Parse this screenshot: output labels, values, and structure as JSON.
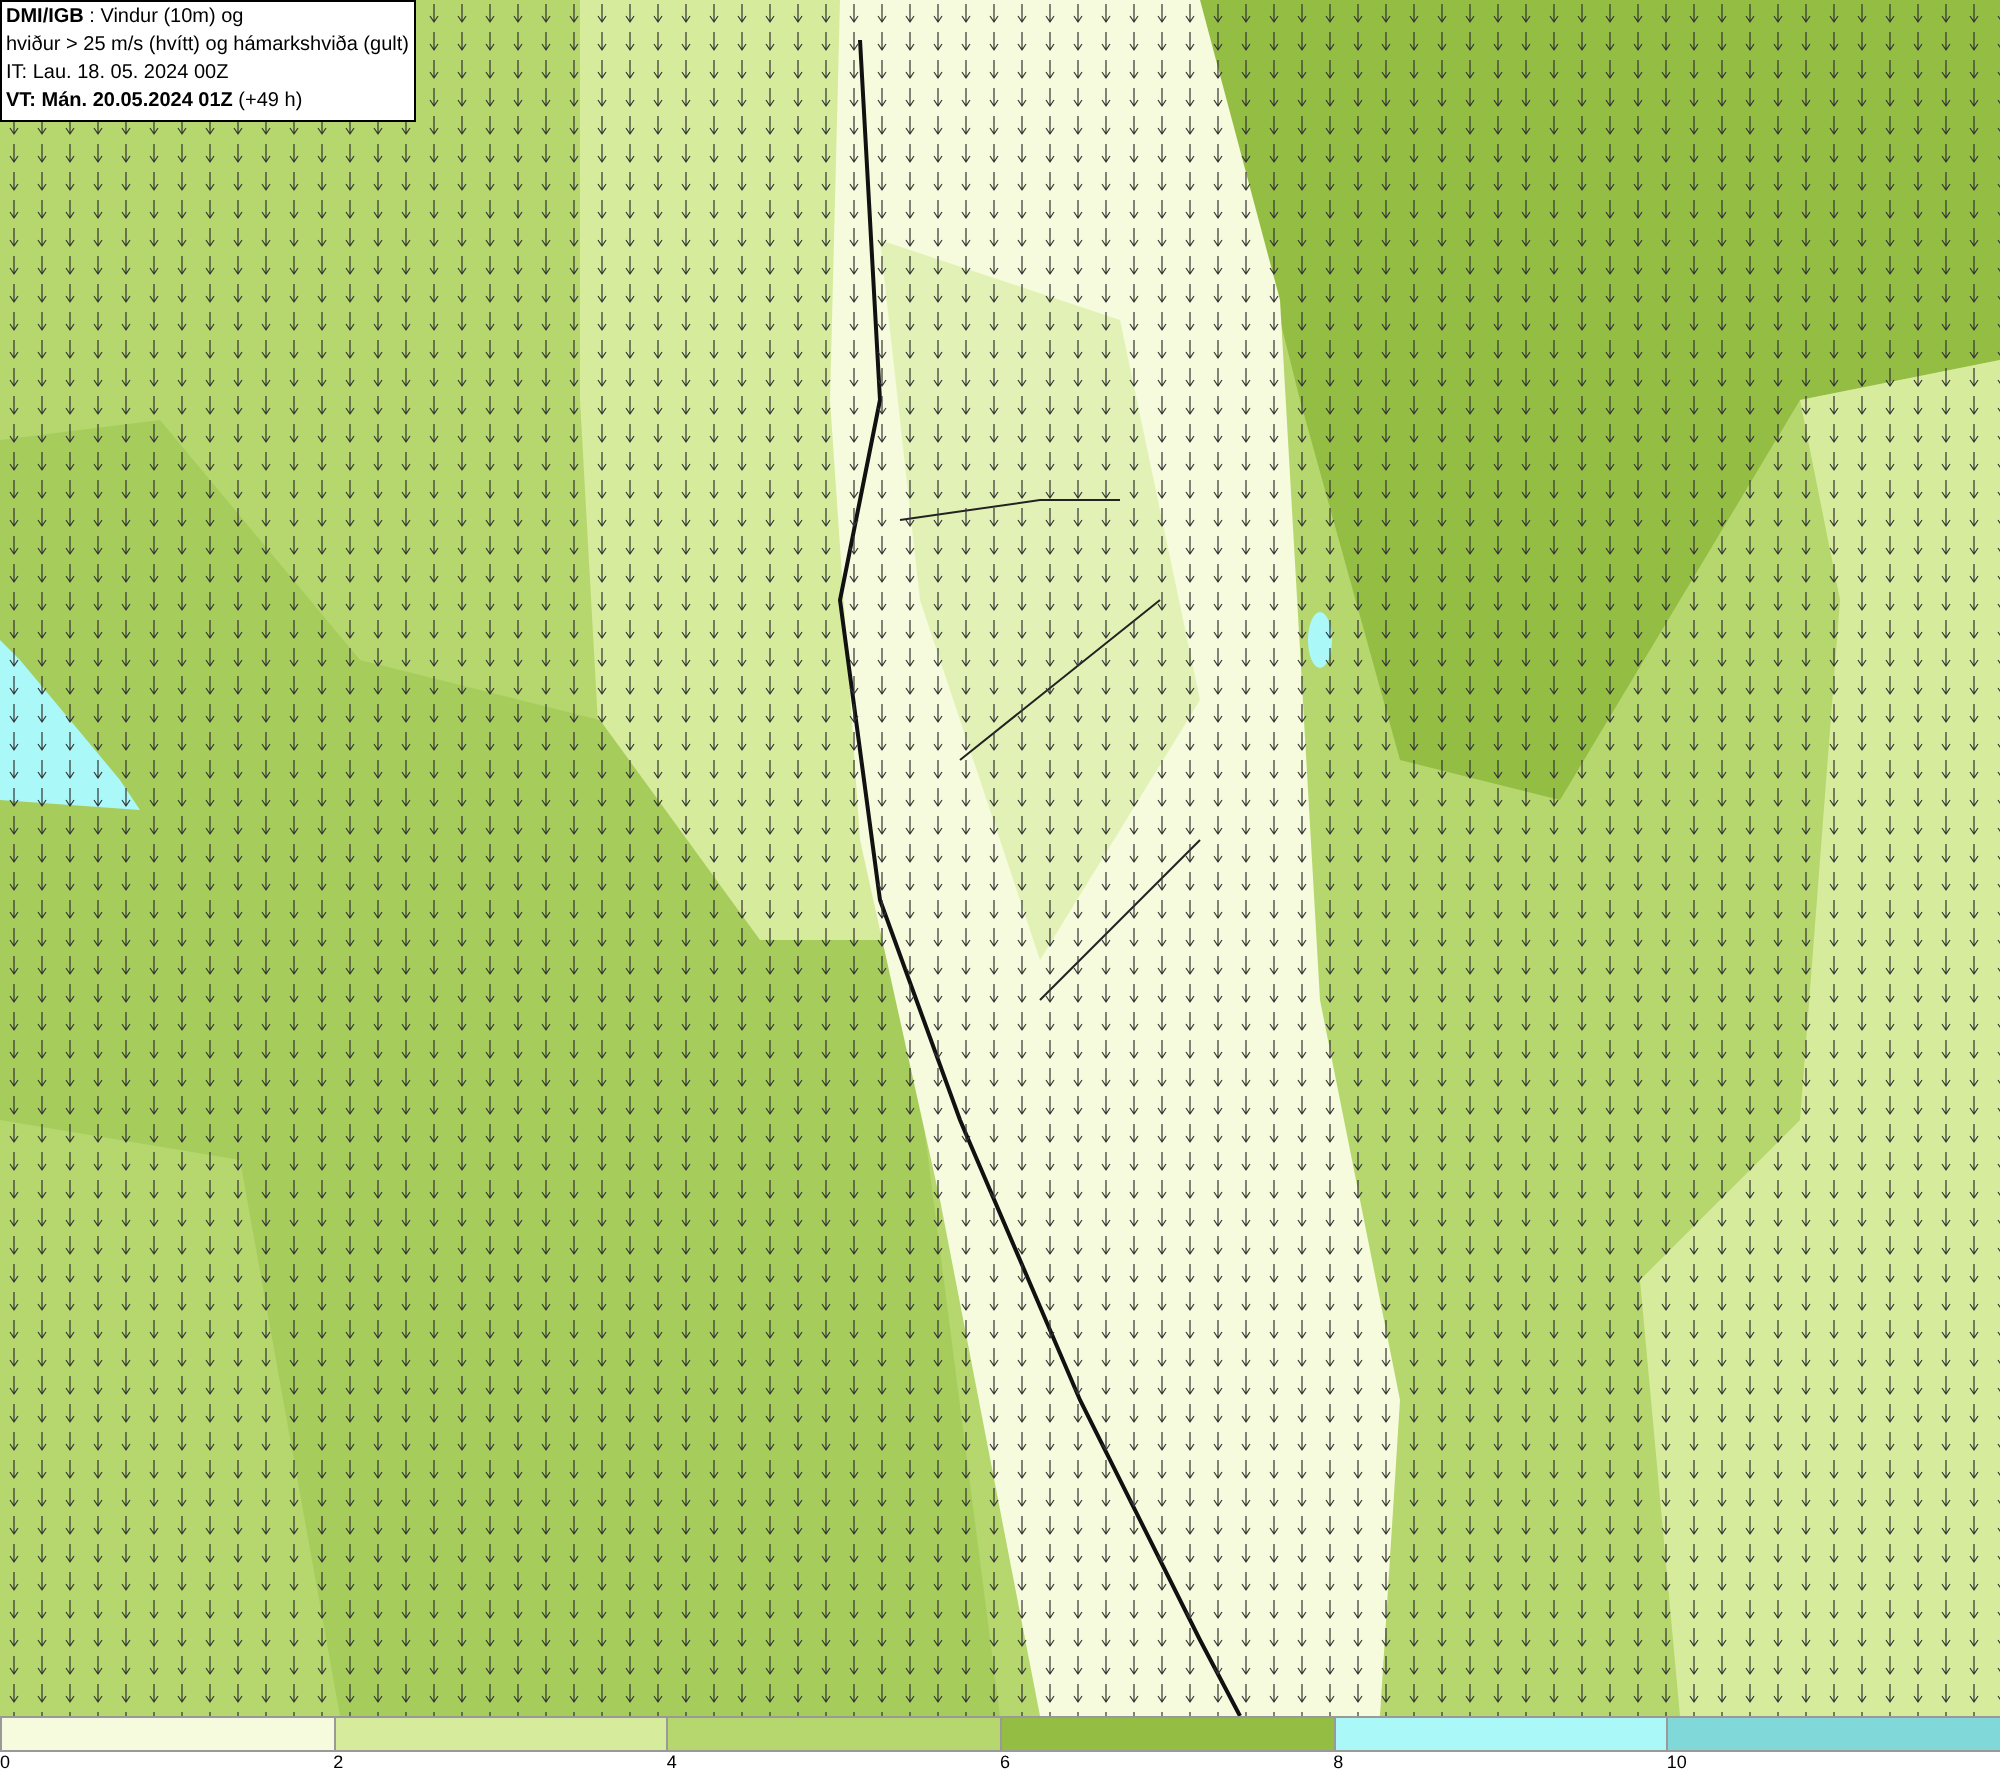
{
  "title_box": {
    "lines": [
      "**DMI/IGB** : Vindur (10m) og",
      "hviður > 25 m/s (hvítt) og hámarkshviða (gult)",
      "IT: Lau. 18. 05. 2024 00Z",
      "**VT: Mán. 20.05.2024 01Z** (+49 h)"
    ]
  },
  "legend": {
    "segments": [
      {
        "color": "#f5fbdc",
        "label": "0"
      },
      {
        "color": "#d6ec9c",
        "label": "2"
      },
      {
        "color": "#b5d76e",
        "label": "4"
      },
      {
        "color": "#94bd44",
        "label": "6"
      },
      {
        "color": "#aaf8f8",
        "label": "8"
      },
      {
        "color": "#80d8d8",
        "label": "10"
      }
    ]
  }
}
